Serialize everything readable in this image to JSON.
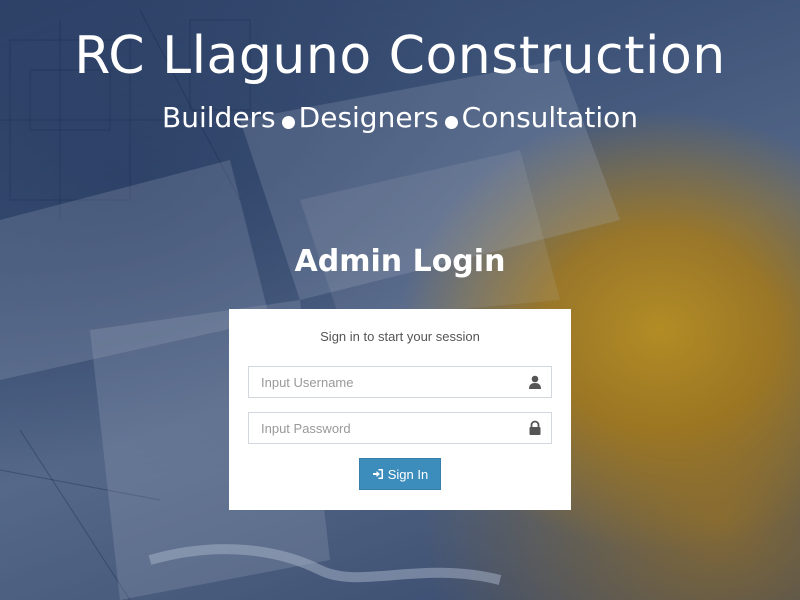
{
  "brand": {
    "title": "RC Llaguno Construction",
    "tagline": [
      "Builders",
      "Designers",
      "Consultation"
    ]
  },
  "login": {
    "heading": "Admin Login",
    "message": "Sign in to start your session",
    "username_placeholder": "Input Username",
    "password_placeholder": "Input Password",
    "username_value": "",
    "password_value": "",
    "submit_label": "Sign In",
    "icons": {
      "username": "user-icon",
      "password": "lock-icon",
      "submit": "sign-in-icon"
    }
  },
  "colors": {
    "button_bg": "#3c8dbc",
    "box_bg": "#ffffff",
    "heading_text": "#ffffff"
  }
}
